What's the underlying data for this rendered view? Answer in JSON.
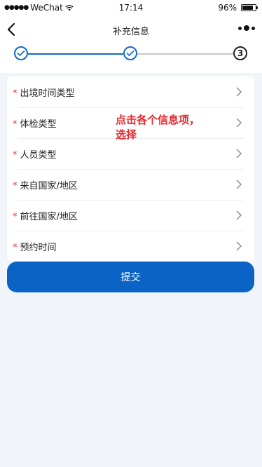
{
  "status_bar": {
    "carrier": "WeChat",
    "time": "17:14",
    "battery_percent": "96%",
    "battery_level": 0.96
  },
  "nav": {
    "title": "补充信息"
  },
  "steps": [
    {
      "state": "done",
      "label": ""
    },
    {
      "state": "done",
      "label": ""
    },
    {
      "state": "current",
      "label": "3"
    }
  ],
  "form": {
    "required_mark": "*",
    "items": [
      {
        "label": "出境时间类型"
      },
      {
        "label": "体检类型"
      },
      {
        "label": "人员类型"
      },
      {
        "label": "来自国家/地区"
      },
      {
        "label": "前往国家/地区"
      },
      {
        "label": "预约时间"
      }
    ]
  },
  "annotation": {
    "line1": "点击各个信息项，",
    "line2": "选择"
  },
  "submit_label": "提交",
  "colors": {
    "accent": "#0b64c5",
    "annotation": "#e8262b",
    "required": "#e5342d",
    "background": "#f1f4f9"
  }
}
